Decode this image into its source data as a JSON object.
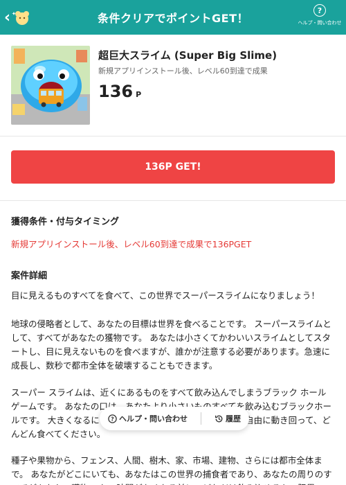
{
  "header": {
    "title": "条件クリアでポイントGET！",
    "help_label": "ヘルプ・問い合わせ",
    "help_icon": "question-circle-icon",
    "back_icon": "chevron-left-icon"
  },
  "app": {
    "name": "超巨大スライム (Super Big Slime)",
    "condition": "新規アプリインストール後、レベル60到達で成果",
    "points": "136",
    "points_unit": "P"
  },
  "get_button": {
    "label": "136P GET!"
  },
  "acquisition": {
    "title": "獲得条件・付与タイミング",
    "text": "新規アプリインストール後、レベル60到達で成果で136PGET"
  },
  "details": {
    "title": "案件詳細",
    "paragraphs": [
      "目に見えるものすべてを食べて、この世界でスーパースライムになりましょう！",
      "地球の侵略者として、あなたの目標は世界を食べることです。 スーパースライムとして、すべてがあなたの獲物です。 あなたは小さくてかわいいスライムとしてスタートし、目に見えないものを食べますが、誰かが注意する必要があります。急速に成長し、数秒で都市全体を破壊することもできます。",
      "スーパー スライムは、近くにあるものをすべて飲み込んでしまうブラック ホール ゲームです。 あなたの口は、あなたより小さいものすべてを飲み込むブラックホールです。 大きくなるにつれて、もっと多くのものを食べて、自由に動き回って、どんどん食べてください。",
      "種子や果物から、フェンス、人間、樹木、家、市場、建物、さらには都市全体まで。 あなたがどこにいても、あなたはこの世界の捕食者であり、あなたの周りのすべてがあなたの獲物です。 時間がなくなる前に、どれだけ飲み込めるかの限界"
    ]
  },
  "floating_bar": {
    "help_label": "ヘルプ・問い合わせ",
    "history_label": "履歴"
  },
  "colors": {
    "header_bg": "#1aa29c",
    "get_button_bg": "#ef4444",
    "accent_text": "#e53935"
  }
}
